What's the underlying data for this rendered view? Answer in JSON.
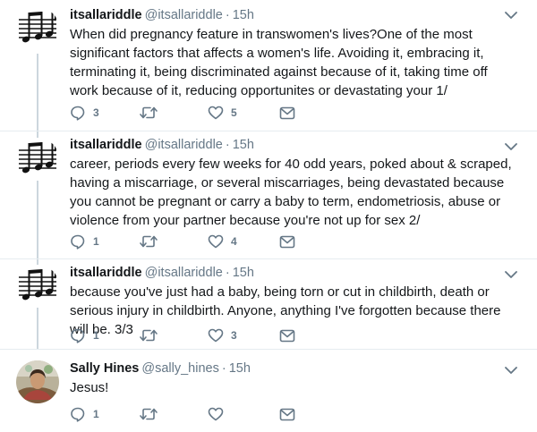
{
  "tweets": [
    {
      "author_name": "itsallariddle",
      "handle": "@itsallariddle",
      "separator": "·",
      "time": "15h",
      "avatar_icon": "music-notes-icon",
      "text": "When did pregnancy feature in transwomen's lives?One of the most significant factors that affects a women's life. Avoiding it, embracing it, terminating it, being discriminated against because of it, taking time off work because of it, reducing opportunites or devastating your 1/",
      "reply_count": "3",
      "retweet_count": "",
      "like_count": "5"
    },
    {
      "author_name": "itsallariddle",
      "handle": "@itsallariddle",
      "separator": "·",
      "time": "15h",
      "avatar_icon": "music-notes-icon",
      "text": "career, periods every few weeks for 40 odd years, poked about & scraped, having a miscarriage, or several miscarriages, being devastated because you cannot be pregnant or carry a baby to term, endometriosis, abuse or violence from your partner because you're not up for sex 2/",
      "reply_count": "1",
      "retweet_count": "",
      "like_count": "4"
    },
    {
      "author_name": "itsallariddle",
      "handle": "@itsallariddle",
      "separator": "·",
      "time": "15h",
      "avatar_icon": "music-notes-icon",
      "text": "because you've just had a baby, being torn or cut in childbirth, death or serious injury in childbirth. Anyone, anything I've forgotten because there will be. 3/3",
      "reply_count": "1",
      "retweet_count": "",
      "like_count": "3"
    },
    {
      "author_name": "Sally Hines",
      "handle": "@sally_hines",
      "separator": "·",
      "time": "15h",
      "avatar_icon": "profile-photo",
      "text": "Jesus!",
      "reply_count": "1",
      "retweet_count": "",
      "like_count": ""
    }
  ],
  "icons": {
    "reply": "reply-icon",
    "retweet": "retweet-icon",
    "like": "heart-icon",
    "dm": "envelope-icon",
    "menu": "chevron-down-icon"
  },
  "colors": {
    "action_gray": "#657786",
    "thread_line": "#ccd6dd",
    "divider": "#e6ecf0",
    "name": "#14171a"
  }
}
